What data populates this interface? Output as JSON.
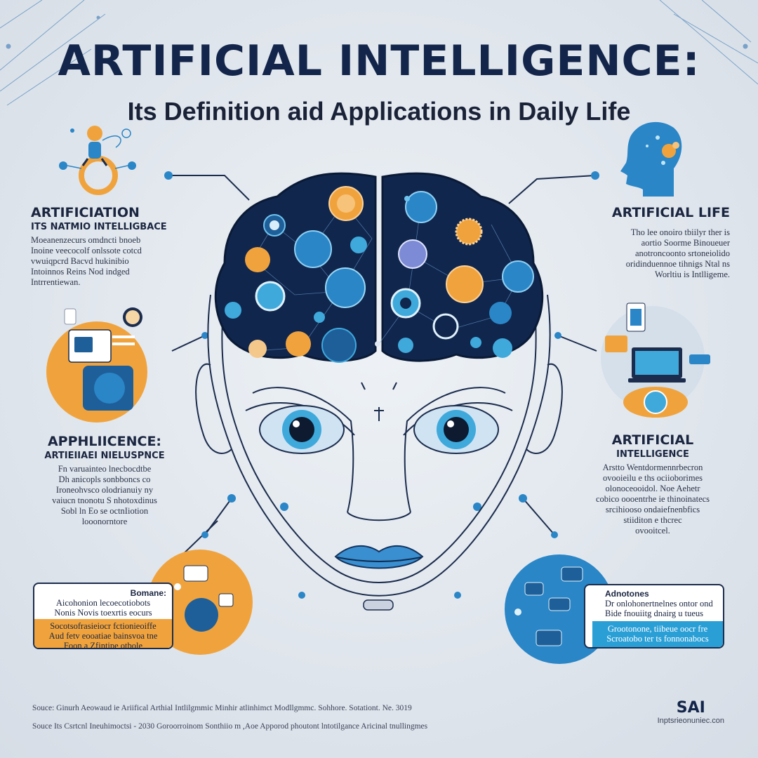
{
  "header": {
    "title": "ARTIFICIAL INTELLIGENCE:",
    "subtitle": "Its Definition aid Applications in Daily Life"
  },
  "sections": {
    "top_left": {
      "heading": "ARTIFICIATION",
      "subheading": "ITS NATMIO INTELLIGBACE",
      "lines": [
        "Moeanenzecurs omdncti bnoeb",
        "Inoine veecocolf onlssote cotcd",
        "vwuiqpcrd Bacvd hukinibio",
        "Intoinnos Reins Nod indged",
        "Intrrentiewan."
      ]
    },
    "top_right": {
      "heading": "ARTIFICIAL LIFE",
      "lines": [
        "Tho lee onoiro tbiilyr ther is",
        "aortio Soorme Binoueuer",
        "anotroncoonto srtoneiolido",
        "oridinduennoe tihnigs Ntal ns",
        "Worltiu is Intlligeme."
      ]
    },
    "mid_left": {
      "heading": "APPHLIICENCE:",
      "subheading": "ARTIEIIAEI NIELUSPNCE",
      "lines": [
        "Fn varuainteo lnecbocdtbe",
        "Dh anicopls sonbboncs co",
        "Ironeohvsco olodrianuiy ny",
        "vaiucn tnonotu S nhotoxdinus",
        "Sobl ln Eo se octnIiotion",
        "looonorntore"
      ]
    },
    "mid_right": {
      "heading": "ARTIFICIAL",
      "subheading": "INTELLIGENCE",
      "lines": [
        "Arstto Wentdormennrbecron",
        "ovooieilu e ths ociioborimes",
        "olonoceooidol. Noe Aehetr",
        "cobico oooentrhe ie thinoinatecs",
        "srcihiooso ondaiefnenbfics",
        "stiiditon e thcrec",
        "ovooitcel."
      ]
    },
    "bottom_left": {
      "header": "Bomane:",
      "lines_white": [
        "Aicohonion lecoecotiobots",
        "Nonis Novis toexrtis eocurs"
      ],
      "lines_orange": [
        "Socotsofrasieiocr fctionieoiffe",
        "Aud fetv eooatiae bainsvoa tne",
        "Foon a Zfintipe otbole"
      ]
    },
    "bottom_right": {
      "header": "Adnotones",
      "lines_white": [
        "Dr onlohonertnelnes ontor ond",
        "Bide fnouiitg dnairg u tueus"
      ],
      "lines_blue": [
        "Grootonone, tiibeue oocr fre",
        "Scroatobo ter ts fonnonabocs"
      ]
    },
    "footer": {
      "source_line_1": "Souce: Ginurh Aeowaud ie Ariifical Arthial Intlilgmmic Minhir atlinhimct Modllgmmc. Sohhore. Sotationt. Ne. 3019",
      "source_line_2": "Souce Its Csrtcnl Ineuhimoctsi - 2030 Goroorroinom Sonthiio m ,Aoe Apporod phoutont lntotilgance Aricinal tnullingmes",
      "brand": "SAI",
      "brand_url": "Inptsrieonuniec.con"
    }
  },
  "icons": {
    "brain": "brain-network-icon",
    "head": "robot-face-icon",
    "person": "person-ring-icon",
    "ai_head": "ai-head-icon",
    "devices": "devices-icon",
    "tablet": "tablet-icon"
  },
  "colors": {
    "navy": "#13254a",
    "brain_dark": "#10264d",
    "orange": "#f0a33d",
    "blue": "#2a86c7",
    "cyan": "#3fa9dc",
    "background": "#dfe5ec"
  }
}
